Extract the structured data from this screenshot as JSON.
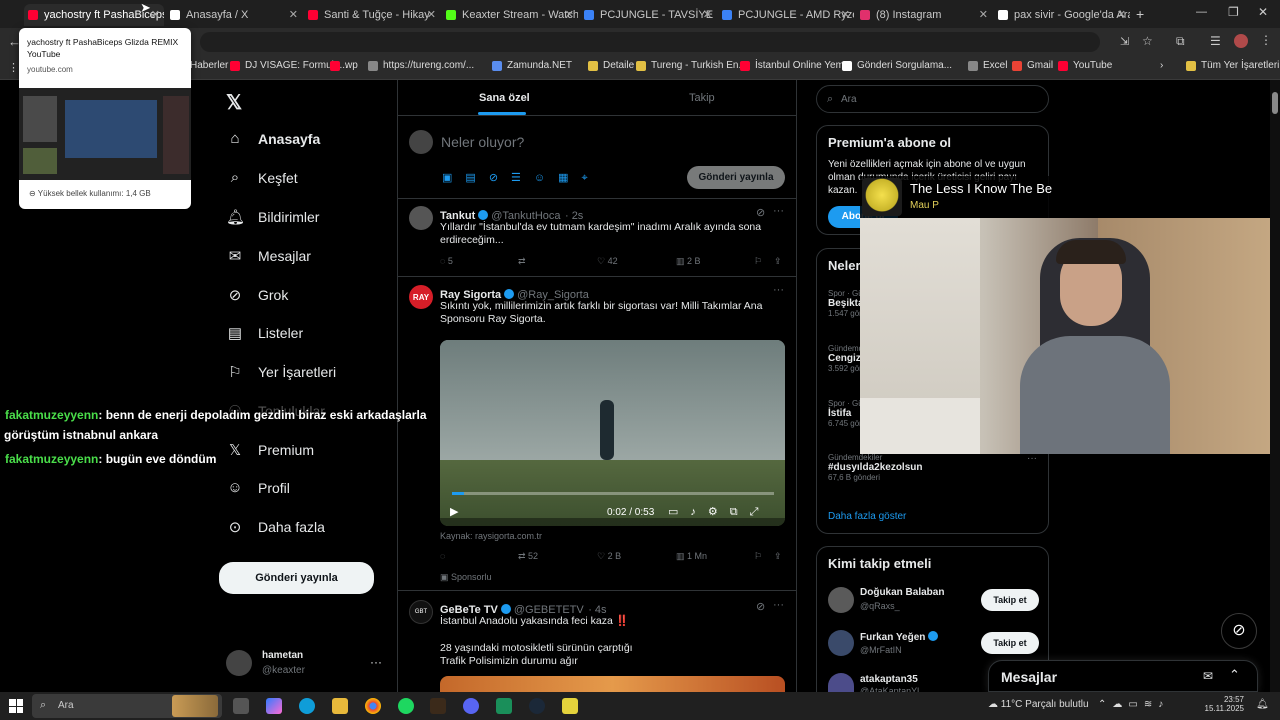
{
  "tabs": [
    {
      "title": "yachostry ft PashaBiceps",
      "color": "#ff0033"
    },
    {
      "title": "Anasayfa / X",
      "color": "#ffffff"
    },
    {
      "title": "Santi & Tuğçe - Hikay",
      "color": "#ff0033"
    },
    {
      "title": "Keaxter Stream - Watch L",
      "color": "#53fc18"
    },
    {
      "title": "PCJUNGLE - TAVSİYE SİST",
      "color": "#3b82f6"
    },
    {
      "title": "PCJUNGLE - AMD Ryzen",
      "color": "#3b82f6"
    },
    {
      "title": "(8) Instagram",
      "color": "#e1306c"
    },
    {
      "title": "pax sivir - Google'da Ara",
      "color": "#ffffff"
    }
  ],
  "tab_tooltip": {
    "line1": "yachostry ft PashaBiceps Glizda REMIX",
    "line2": "YouTube",
    "url": "youtube.com",
    "memory": "Yüksek bellek kullanımı: 1,4 GB"
  },
  "bookmarks": [
    {
      "label": "Haberler",
      "color": "#888"
    },
    {
      "label": "DJ VISAGE: Formula...",
      "color": "#ff0033"
    },
    {
      "label": "wp",
      "color": "#ff0033"
    },
    {
      "label": "https://tureng.com/...",
      "color": "#888"
    },
    {
      "label": "Zamunda.NET",
      "color": "#5a8dee"
    },
    {
      "label": "Detaile",
      "color": "#e2c044"
    },
    {
      "label": "Tureng - Turkish En...",
      "color": "#e2c044"
    },
    {
      "label": "İstanbul Online Yem...",
      "color": "#ff0033"
    },
    {
      "label": "Gönderi Sorgulama...",
      "color": "#ffffff"
    },
    {
      "label": "Excel",
      "color": "#888"
    },
    {
      "label": "Gmail",
      "color": "#ea4335"
    },
    {
      "label": "YouTube",
      "color": "#ff0033"
    }
  ],
  "bookmarks_other": "Tüm Yer İşaretleri",
  "nav": {
    "items": [
      "Anasayfa",
      "Keşfet",
      "Bildirimler",
      "Mesajlar",
      "Grok",
      "Listeler",
      "Yer İşaretleri",
      "Topluluklar",
      "Premium",
      "Profil",
      "Daha fazla"
    ],
    "post_button": "Gönderi yayınla",
    "user_name": "hametan",
    "user_handle": "@keaxter"
  },
  "feed": {
    "tab_for_you": "Sana özel",
    "tab_following": "Takip",
    "composer_placeholder": "Neler oluyor?",
    "composer_button": "Gönderi yayınla",
    "tweets": [
      {
        "name": "Tankut",
        "handle": "@TankutHoca",
        "time": "· 2s",
        "text": "Yıllardır \"İstanbul'da ev tutmam kardeşim\" inadımı Aralık ayında sona erdireceğim...",
        "replies": "5",
        "likes": "42",
        "views": "2 B"
      },
      {
        "name": "Ray Sigorta",
        "handle": "@Ray_Sigorta",
        "text": "Sıkıntı yok, millilerimizin artık farklı bir sigortası var! Milli Takımlar Ana Sponsoru Ray Sigorta.",
        "video_time": "0:02 / 0:53",
        "source": "Kaynak: raysigorta.com.tr",
        "retweets": "52",
        "likes": "2 B",
        "views": "1 Mn",
        "promoted": "Sponsorlu"
      },
      {
        "name": "GeBeTe TV",
        "handle": "@GEBETETV",
        "time": "· 4s",
        "text1": "İstanbul Anadolu yakasında feci kaza ‼️",
        "text2": "28 yaşındaki motosikletli sürünün çarptığı",
        "text3": "Trafik Polisimizin durumu ağır"
      }
    ]
  },
  "sidebar": {
    "search_placeholder": "Ara",
    "premium_title": "Premium'a abone ol",
    "premium_text": "Yeni özellikleri açmak için abone ol ve uygun olman durumunda içerik üreticisi geliri payı kazan.",
    "premium_button": "Abone ol",
    "trends_title": "Neler oluyor",
    "trends": [
      {
        "cat": "Spor · Gündemde",
        "topic": "Beşiktaş",
        "count": "1.547 gönderi"
      },
      {
        "cat": "Gündemde",
        "topic": "Cengiz",
        "count": "3.592 gönderi"
      },
      {
        "cat": "Spor · Gündemde",
        "topic": "İstifa",
        "count": "6.745 gönderi"
      },
      {
        "cat": "Gündemdekiler",
        "topic": "#dusyılda2kezolsun",
        "count": "67,6 B gönderi"
      }
    ],
    "show_more": "Daha fazla göster",
    "who_to_follow": "Kimi takip etmeli",
    "follow_suggestions": [
      {
        "name": "Doğukan Balaban",
        "handle": "@qRaxs_"
      },
      {
        "name": "Furkan Yeğen",
        "handle": "@MrFatIN"
      },
      {
        "name": "atakaptan35",
        "handle": "@AtaKaptanYl"
      }
    ],
    "follow_label": "Takip et",
    "messages": "Mesajlar"
  },
  "now_playing": {
    "title": "The Less I Know The Be",
    "artist": "Mau P"
  },
  "stream_chat": [
    {
      "user": "fakatmuzeyyenn",
      "message": ": benn de enerji depoladım gezdim biraz eski arkadaşlarla"
    },
    {
      "user": "",
      "message": "görüştüm istnabnul ankara"
    },
    {
      "user": "fakatmuzeyyenn",
      "message": ": bugün eve döndüm"
    }
  ],
  "taskbar": {
    "search": "Ara",
    "weather": "11°C  Parçalı bulutlu",
    "time": "23:57",
    "date": "15.11.2025"
  }
}
